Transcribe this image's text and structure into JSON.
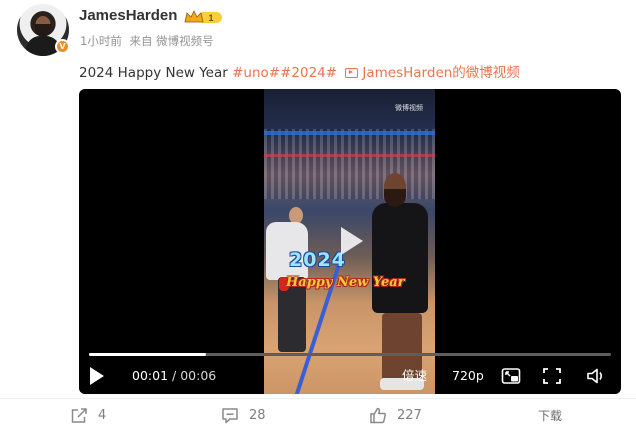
{
  "user": {
    "name": "JamesHarden",
    "crown_level": "1",
    "time_ago": "1小时前",
    "source": "来自 微博视频号"
  },
  "post": {
    "text_plain": "2024 Happy New Year ",
    "hashtags": "#uno##2024#",
    "video_link": "JamesHarden的微博视频"
  },
  "video": {
    "watermark": "微博视频",
    "overlay_year": "2024",
    "overlay_greeting": "Happy New Year",
    "current_time": "00:01",
    "separator": " / ",
    "duration": "00:06",
    "progress_fraction": 0.225,
    "speed_label": "倍速",
    "quality_label": "720p"
  },
  "actions": {
    "shares": "4",
    "comments": "28",
    "likes": "227",
    "download": "下载"
  },
  "colors": {
    "accent": "#eb7350",
    "meta": "#939393",
    "verify": "#f28a1d"
  },
  "icons": {
    "share": "share-icon",
    "comment": "comment-icon",
    "like": "thumbs-up-icon",
    "pip": "picture-in-picture-icon",
    "fullscreen": "fullscreen-icon",
    "volume": "volume-icon"
  }
}
